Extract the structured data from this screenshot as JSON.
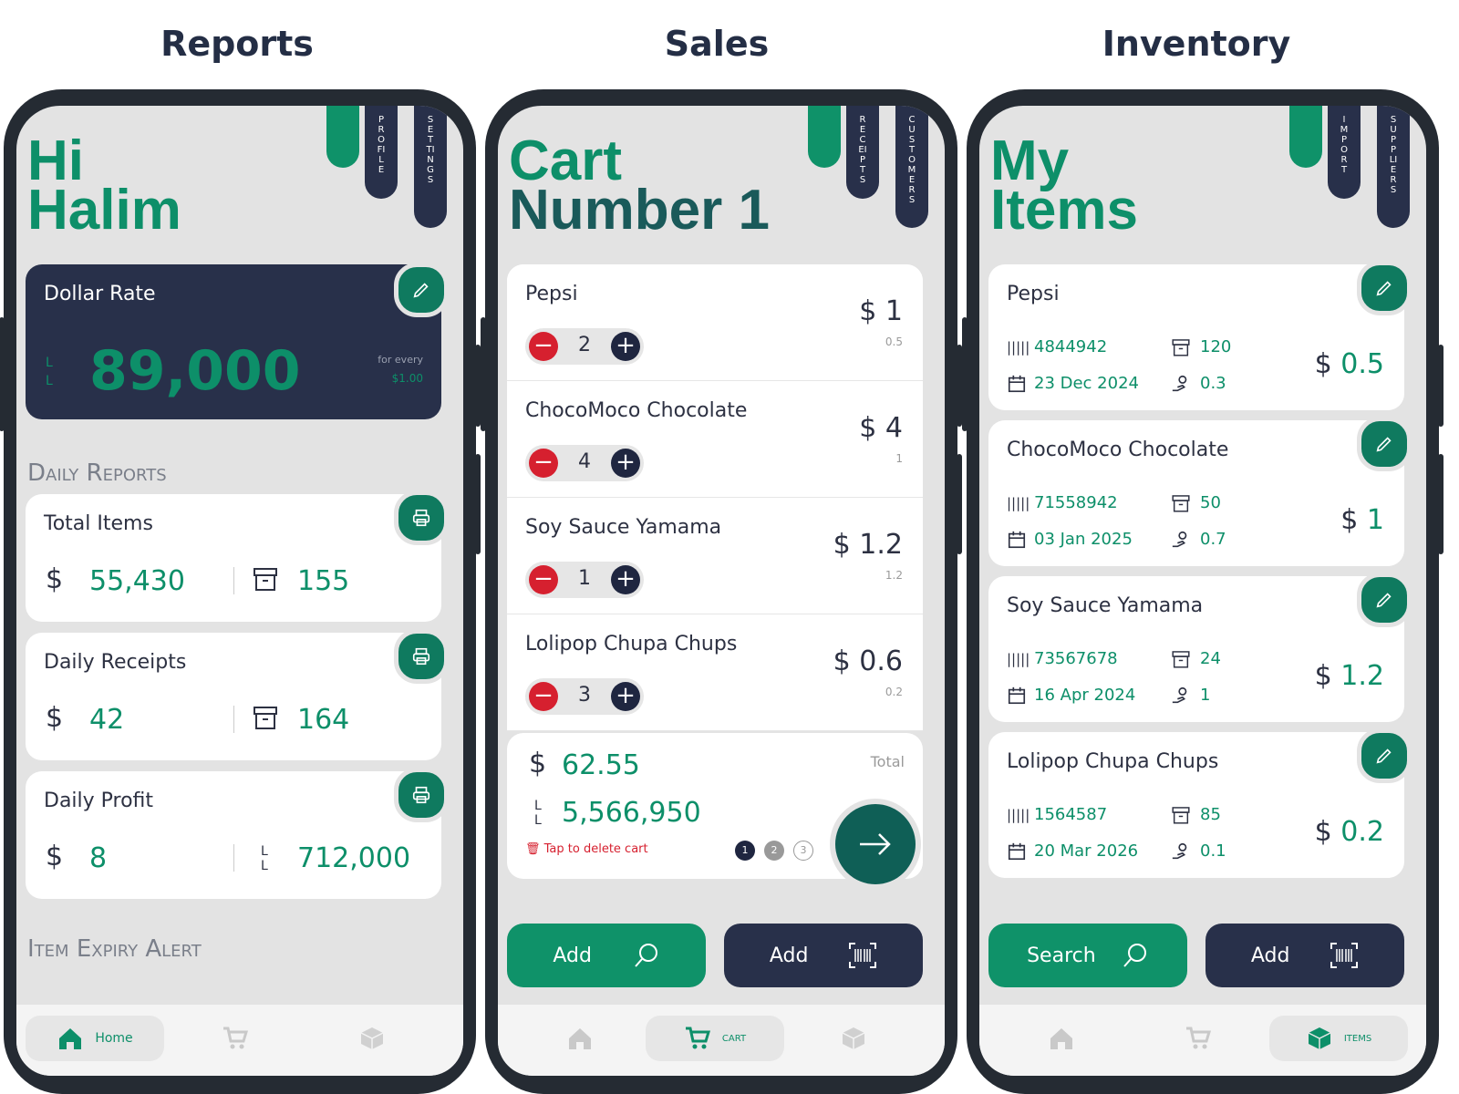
{
  "headings": {
    "reports": "Reports",
    "sales": "Sales",
    "inventory": "Inventory"
  },
  "reports": {
    "tabs": [
      "PROFILE",
      "SETTINGS"
    ],
    "greeting": [
      "Hi",
      "Halim"
    ],
    "dollar_rate": {
      "title": "Dollar Rate",
      "currency": "LL",
      "value": "89,000",
      "note": "for every",
      "per": "$1.00"
    },
    "daily_reports_label": "Daily Reports",
    "cards": [
      {
        "title": "Total Items",
        "left_symbol": "$",
        "left": "55,430",
        "right_symbol": "box",
        "right": "155"
      },
      {
        "title": "Daily Receipts",
        "left_symbol": "$",
        "left": "42",
        "right_symbol": "box",
        "right": "164"
      },
      {
        "title": "Daily Profit",
        "left_symbol": "$",
        "left": "8",
        "right_symbol": "LL",
        "right": "712,000"
      }
    ],
    "expiry_label": "Item Expiry Alert",
    "nav": {
      "active": "Home"
    }
  },
  "sales": {
    "tabs": [
      "RECEIPTS",
      "CUSTOMERS"
    ],
    "title": [
      "Cart",
      "Number 1"
    ],
    "items": [
      {
        "name": "Pepsi",
        "qty": "2",
        "price": "1",
        "unit": "0.5"
      },
      {
        "name": "ChocoMoco Chocolate",
        "qty": "4",
        "price": "4",
        "unit": "1"
      },
      {
        "name": "Soy Sauce Yamama",
        "qty": "1",
        "price": "1.2",
        "unit": "1.2"
      },
      {
        "name": "Lolipop Chupa Chups",
        "qty": "3",
        "price": "0.6",
        "unit": "0.2"
      }
    ],
    "total_label": "Total",
    "total_usd": "62.55",
    "total_ll": "5,566,950",
    "delete_hint": "Tap to delete cart",
    "pages": [
      "1",
      "2",
      "3"
    ],
    "buttons": {
      "add_search": "Add",
      "add_scan": "Add"
    },
    "nav": {
      "active": "CART"
    }
  },
  "inventory": {
    "tabs": [
      "IMPORT",
      "SUPPLIERS"
    ],
    "title": [
      "My",
      "Items"
    ],
    "items": [
      {
        "name": "Pepsi",
        "barcode": "4844942",
        "stock": "120",
        "date": "23 Dec 2024",
        "cost": "0.3",
        "price": "0.5"
      },
      {
        "name": "ChocoMoco Chocolate",
        "barcode": "71558942",
        "stock": "50",
        "date": "03 Jan 2025",
        "cost": "0.7",
        "price": "1"
      },
      {
        "name": "Soy Sauce Yamama",
        "barcode": "73567678",
        "stock": "24",
        "date": "16 Apr 2024",
        "cost": "1",
        "price": "1.2"
      },
      {
        "name": "Lolipop Chupa Chups",
        "barcode": "1564587",
        "stock": "85",
        "date": "20 Mar 2026",
        "cost": "0.1",
        "price": "0.2"
      }
    ],
    "buttons": {
      "search": "Search",
      "add_scan": "Add"
    },
    "nav": {
      "active": "ITEMS"
    }
  },
  "colors": {
    "green": "#0f9269",
    "navy": "#28304a",
    "red": "#d6202f",
    "bg": "#e3e3e3"
  }
}
